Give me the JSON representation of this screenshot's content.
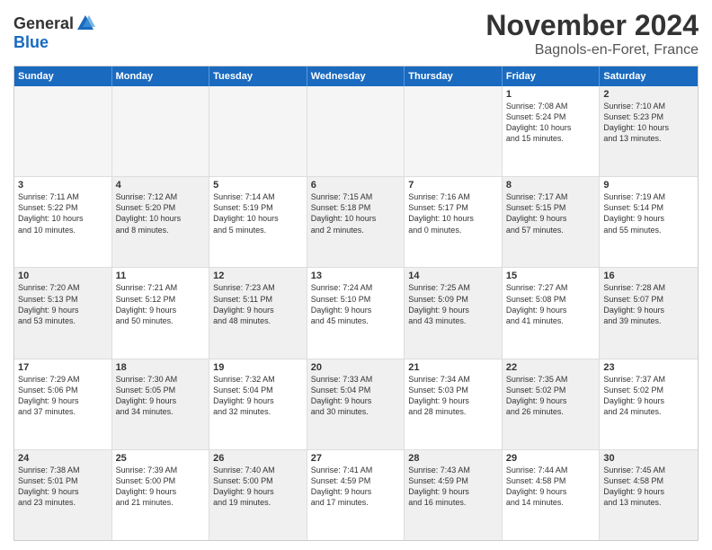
{
  "logo": {
    "general": "General",
    "blue": "Blue"
  },
  "title": "November 2024",
  "location": "Bagnols-en-Foret, France",
  "dayNames": [
    "Sunday",
    "Monday",
    "Tuesday",
    "Wednesday",
    "Thursday",
    "Friday",
    "Saturday"
  ],
  "rows": [
    [
      {
        "day": "",
        "info": "",
        "empty": true
      },
      {
        "day": "",
        "info": "",
        "empty": true
      },
      {
        "day": "",
        "info": "",
        "empty": true
      },
      {
        "day": "",
        "info": "",
        "empty": true
      },
      {
        "day": "",
        "info": "",
        "empty": true
      },
      {
        "day": "1",
        "info": "Sunrise: 7:08 AM\nSunset: 5:24 PM\nDaylight: 10 hours\nand 15 minutes.",
        "empty": false
      },
      {
        "day": "2",
        "info": "Sunrise: 7:10 AM\nSunset: 5:23 PM\nDaylight: 10 hours\nand 13 minutes.",
        "empty": false,
        "shaded": true
      }
    ],
    [
      {
        "day": "3",
        "info": "Sunrise: 7:11 AM\nSunset: 5:22 PM\nDaylight: 10 hours\nand 10 minutes.",
        "empty": false
      },
      {
        "day": "4",
        "info": "Sunrise: 7:12 AM\nSunset: 5:20 PM\nDaylight: 10 hours\nand 8 minutes.",
        "empty": false,
        "shaded": true
      },
      {
        "day": "5",
        "info": "Sunrise: 7:14 AM\nSunset: 5:19 PM\nDaylight: 10 hours\nand 5 minutes.",
        "empty": false
      },
      {
        "day": "6",
        "info": "Sunrise: 7:15 AM\nSunset: 5:18 PM\nDaylight: 10 hours\nand 2 minutes.",
        "empty": false,
        "shaded": true
      },
      {
        "day": "7",
        "info": "Sunrise: 7:16 AM\nSunset: 5:17 PM\nDaylight: 10 hours\nand 0 minutes.",
        "empty": false
      },
      {
        "day": "8",
        "info": "Sunrise: 7:17 AM\nSunset: 5:15 PM\nDaylight: 9 hours\nand 57 minutes.",
        "empty": false,
        "shaded": true
      },
      {
        "day": "9",
        "info": "Sunrise: 7:19 AM\nSunset: 5:14 PM\nDaylight: 9 hours\nand 55 minutes.",
        "empty": false
      }
    ],
    [
      {
        "day": "10",
        "info": "Sunrise: 7:20 AM\nSunset: 5:13 PM\nDaylight: 9 hours\nand 53 minutes.",
        "empty": false,
        "shaded": true
      },
      {
        "day": "11",
        "info": "Sunrise: 7:21 AM\nSunset: 5:12 PM\nDaylight: 9 hours\nand 50 minutes.",
        "empty": false
      },
      {
        "day": "12",
        "info": "Sunrise: 7:23 AM\nSunset: 5:11 PM\nDaylight: 9 hours\nand 48 minutes.",
        "empty": false,
        "shaded": true
      },
      {
        "day": "13",
        "info": "Sunrise: 7:24 AM\nSunset: 5:10 PM\nDaylight: 9 hours\nand 45 minutes.",
        "empty": false
      },
      {
        "day": "14",
        "info": "Sunrise: 7:25 AM\nSunset: 5:09 PM\nDaylight: 9 hours\nand 43 minutes.",
        "empty": false,
        "shaded": true
      },
      {
        "day": "15",
        "info": "Sunrise: 7:27 AM\nSunset: 5:08 PM\nDaylight: 9 hours\nand 41 minutes.",
        "empty": false
      },
      {
        "day": "16",
        "info": "Sunrise: 7:28 AM\nSunset: 5:07 PM\nDaylight: 9 hours\nand 39 minutes.",
        "empty": false,
        "shaded": true
      }
    ],
    [
      {
        "day": "17",
        "info": "Sunrise: 7:29 AM\nSunset: 5:06 PM\nDaylight: 9 hours\nand 37 minutes.",
        "empty": false
      },
      {
        "day": "18",
        "info": "Sunrise: 7:30 AM\nSunset: 5:05 PM\nDaylight: 9 hours\nand 34 minutes.",
        "empty": false,
        "shaded": true
      },
      {
        "day": "19",
        "info": "Sunrise: 7:32 AM\nSunset: 5:04 PM\nDaylight: 9 hours\nand 32 minutes.",
        "empty": false
      },
      {
        "day": "20",
        "info": "Sunrise: 7:33 AM\nSunset: 5:04 PM\nDaylight: 9 hours\nand 30 minutes.",
        "empty": false,
        "shaded": true
      },
      {
        "day": "21",
        "info": "Sunrise: 7:34 AM\nSunset: 5:03 PM\nDaylight: 9 hours\nand 28 minutes.",
        "empty": false
      },
      {
        "day": "22",
        "info": "Sunrise: 7:35 AM\nSunset: 5:02 PM\nDaylight: 9 hours\nand 26 minutes.",
        "empty": false,
        "shaded": true
      },
      {
        "day": "23",
        "info": "Sunrise: 7:37 AM\nSunset: 5:02 PM\nDaylight: 9 hours\nand 24 minutes.",
        "empty": false
      }
    ],
    [
      {
        "day": "24",
        "info": "Sunrise: 7:38 AM\nSunset: 5:01 PM\nDaylight: 9 hours\nand 23 minutes.",
        "empty": false,
        "shaded": true
      },
      {
        "day": "25",
        "info": "Sunrise: 7:39 AM\nSunset: 5:00 PM\nDaylight: 9 hours\nand 21 minutes.",
        "empty": false
      },
      {
        "day": "26",
        "info": "Sunrise: 7:40 AM\nSunset: 5:00 PM\nDaylight: 9 hours\nand 19 minutes.",
        "empty": false,
        "shaded": true
      },
      {
        "day": "27",
        "info": "Sunrise: 7:41 AM\nSunset: 4:59 PM\nDaylight: 9 hours\nand 17 minutes.",
        "empty": false
      },
      {
        "day": "28",
        "info": "Sunrise: 7:43 AM\nSunset: 4:59 PM\nDaylight: 9 hours\nand 16 minutes.",
        "empty": false,
        "shaded": true
      },
      {
        "day": "29",
        "info": "Sunrise: 7:44 AM\nSunset: 4:58 PM\nDaylight: 9 hours\nand 14 minutes.",
        "empty": false
      },
      {
        "day": "30",
        "info": "Sunrise: 7:45 AM\nSunset: 4:58 PM\nDaylight: 9 hours\nand 13 minutes.",
        "empty": false,
        "shaded": true
      }
    ]
  ]
}
